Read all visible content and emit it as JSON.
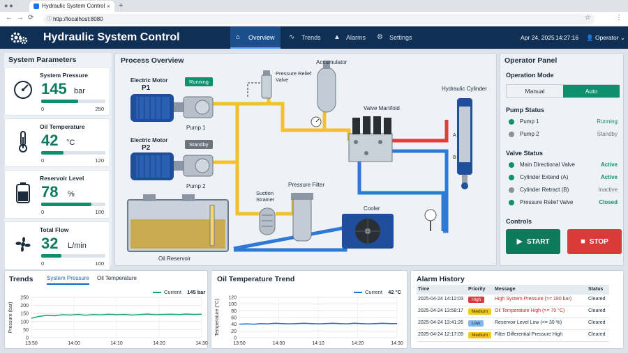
{
  "browser": {
    "tab_title": "Hydraulic System Control",
    "url": "http://localhost:8080"
  },
  "header": {
    "title": "Hydraulic System Control",
    "nav": [
      {
        "label": "Overview",
        "icon": "home-icon",
        "active": true
      },
      {
        "label": "Trends",
        "icon": "trend-icon",
        "active": false
      },
      {
        "label": "Alarms",
        "icon": "warning-icon",
        "active": false
      },
      {
        "label": "Settings",
        "icon": "gear-icon",
        "active": false
      }
    ],
    "date": "Apr 24, 2025",
    "time": "14:27:16",
    "user": "Operator"
  },
  "params": {
    "title": "System Parameters",
    "cards": [
      {
        "label": "System Pressure",
        "value": "145",
        "unit": "bar",
        "min": "0",
        "max": "250",
        "fraction": 0.58,
        "icon": "gauge-icon"
      },
      {
        "label": "Oil Temperature",
        "value": "42",
        "unit": "°C",
        "min": "0",
        "max": "120",
        "fraction": 0.35,
        "icon": "thermometer-icon"
      },
      {
        "label": "Reservoir Level",
        "value": "78",
        "unit": "%",
        "min": "0",
        "max": "100",
        "fraction": 0.78,
        "icon": "tank-icon"
      },
      {
        "label": "Total Flow",
        "value": "32",
        "unit": "L/min",
        "min": "0",
        "max": "100",
        "fraction": 0.32,
        "icon": "fan-icon"
      }
    ]
  },
  "process": {
    "title": "Process Overview",
    "motor1_label": "Electric Motor",
    "motor1_id": "P1",
    "motor1_status": "Running",
    "pump1": "Pump 1",
    "motor2_label": "Electric Motor",
    "motor2_id": "P2",
    "motor2_status": "Standby",
    "pump2": "Pump 2",
    "prv": "Pressure Relief Valve",
    "accumulator": "Accumulator",
    "valve_manifold": "Valve Manifold",
    "cylinder": "Hydraulic Cylinder",
    "cyl_a": "A",
    "cyl_b": "B",
    "suction": "Suction Strainer",
    "filter": "Pressure Filter",
    "cooler": "Cooler",
    "reservoir": "Oil Reservoir"
  },
  "operator": {
    "title": "Operator Panel",
    "mode_title": "Operation Mode",
    "mode_manual": "Manual",
    "mode_auto": "Auto",
    "pump_title": "Pump Status",
    "pumps": [
      {
        "name": "Pump 1",
        "status": "Running",
        "color": "#0e8f6e"
      },
      {
        "name": "Pump 2",
        "status": "Standby",
        "color": "#8a939c"
      }
    ],
    "valve_title": "Valve Status",
    "valves": [
      {
        "name": "Main Directional Valve",
        "status": "Active",
        "color": "#0e8f6e"
      },
      {
        "name": "Cylinder Extend (A)",
        "status": "Active",
        "color": "#0e8f6e"
      },
      {
        "name": "Cylinder Retract (B)",
        "status": "Inactive",
        "color": "#8a939c"
      },
      {
        "name": "Pressure Relief Valve",
        "status": "Closed",
        "color": "#0e8f6e"
      }
    ],
    "controls_title": "Controls",
    "start": "START",
    "stop": "STOP"
  },
  "trends": {
    "title": "Trends",
    "tab_pressure": "System Pressure",
    "tab_temp": "Oil Temperature",
    "legend_current": "Current",
    "legend_value": "145 bar",
    "ylabel": "Pressure (bar)",
    "xticks": [
      "13:50",
      "14:00",
      "14:10",
      "14:20",
      "14:30"
    ],
    "yticks": [
      "0",
      "50",
      "100",
      "150",
      "200",
      "250"
    ]
  },
  "temp_trend": {
    "title": "Oil Temperature Trend",
    "legend_current": "Current",
    "legend_value": "42 °C",
    "ylabel": "Temperature (°C)",
    "xticks": [
      "13:50",
      "14:00",
      "14:10",
      "14:20",
      "14:30"
    ],
    "yticks": [
      "0",
      "20",
      "40",
      "60",
      "80",
      "100",
      "120"
    ]
  },
  "chart_data": [
    {
      "type": "line",
      "title": "",
      "xlabel": "",
      "ylabel": "Pressure (bar)",
      "ylim": [
        0,
        250
      ],
      "series": [
        {
          "name": "Current",
          "values": [
            120,
            132,
            138,
            136,
            142,
            140,
            144,
            139,
            143,
            141,
            145,
            142,
            144,
            140,
            143,
            146,
            142,
            144,
            145,
            143,
            146,
            144,
            145
          ]
        }
      ],
      "x": [
        "13:50",
        "14:00",
        "14:10",
        "14:20",
        "14:30"
      ],
      "grid": true,
      "legend": "top-right"
    },
    {
      "type": "line",
      "title": "Oil Temperature Trend",
      "xlabel": "",
      "ylabel": "Temperature (°C)",
      "ylim": [
        0,
        120
      ],
      "series": [
        {
          "name": "Current",
          "values": [
            40,
            41,
            40,
            42,
            41,
            43,
            42,
            41,
            42,
            43,
            42,
            41,
            42,
            43,
            42,
            41,
            43,
            42,
            41,
            42,
            43,
            42,
            42
          ]
        }
      ],
      "x": [
        "13:50",
        "14:00",
        "14:10",
        "14:20",
        "14:30"
      ],
      "grid": true,
      "legend": "top-right"
    }
  ],
  "alarms": {
    "title": "Alarm History",
    "headers": [
      "Time",
      "Priority",
      "Message",
      "Status"
    ],
    "rows": [
      {
        "time": "2025-04-24 14:12:03",
        "priority": "High",
        "pcolor": "#d93b3b",
        "ptext": "#ffffff",
        "message": "High System Pressure (>= 180 bar)",
        "mcolor": "#c62828",
        "status": "Cleared"
      },
      {
        "time": "2025-04-24 13:58:17",
        "priority": "Medium",
        "pcolor": "#f5c518",
        "ptext": "#3a2c00",
        "message": "Oil Temperature High (>= 70 °C)",
        "mcolor": "#c62828",
        "status": "Cleared"
      },
      {
        "time": "2025-04-24 13:41:26",
        "priority": "Low",
        "pcolor": "#7fb6f0",
        "ptext": "#0b2a4a",
        "message": "Reservoir Level Low (<= 30 %)",
        "mcolor": "#1b2a3a",
        "status": "Cleared"
      },
      {
        "time": "2025-04-24 12:17:09",
        "priority": "Medium",
        "pcolor": "#f5c518",
        "ptext": "#3a2c00",
        "message": "Filter Differential Pressure High",
        "mcolor": "#1b2a3a",
        "status": "Cleared"
      }
    ]
  }
}
